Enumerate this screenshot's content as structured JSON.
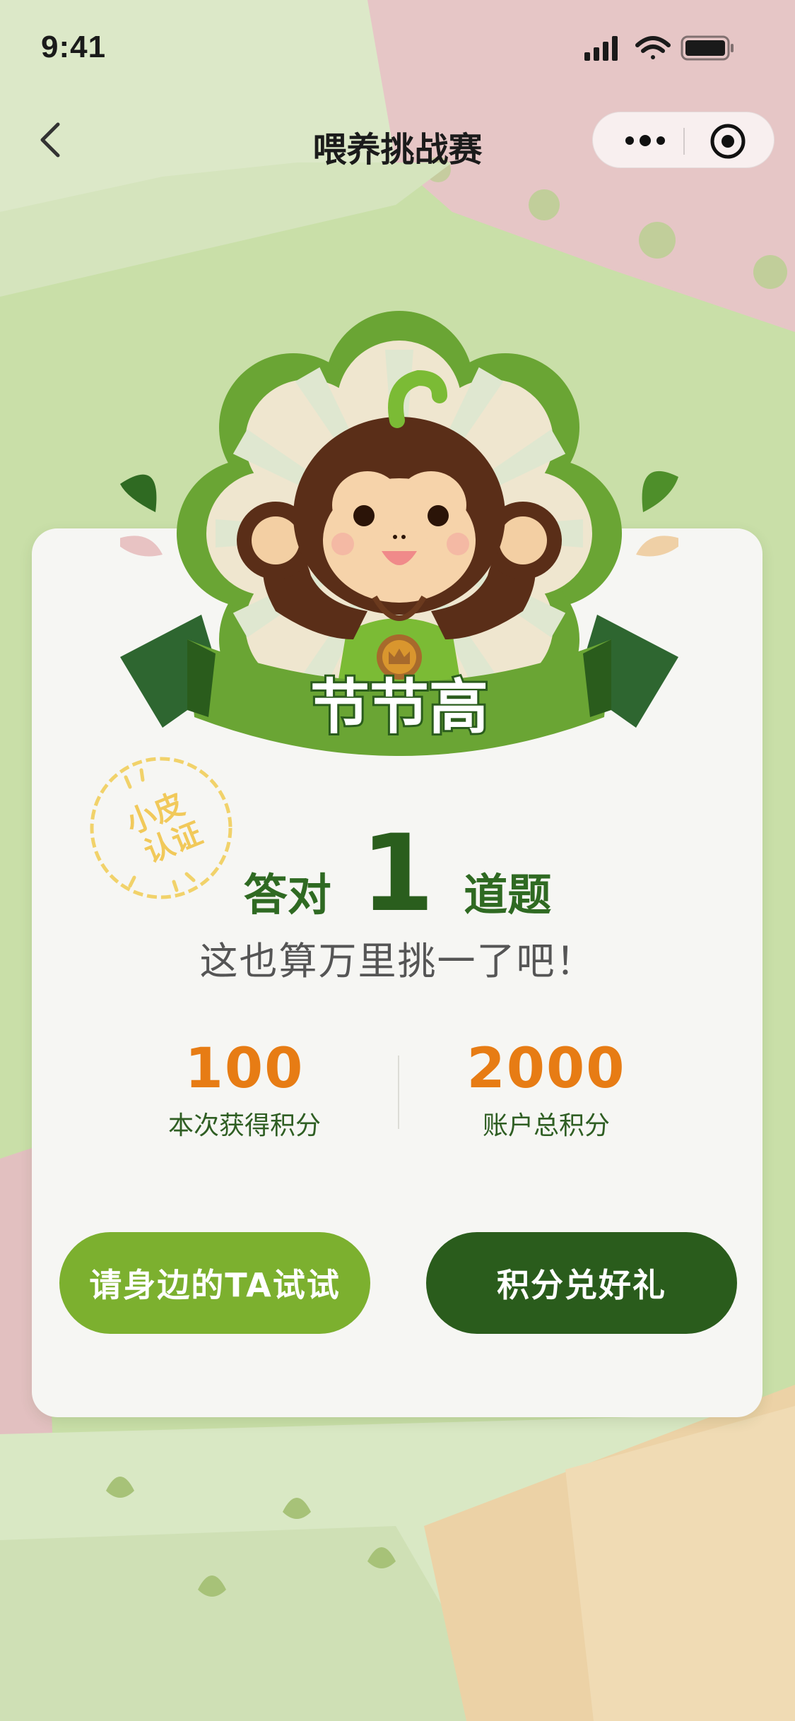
{
  "status_bar": {
    "time": "9:41"
  },
  "nav": {
    "title": "喂养挑战赛"
  },
  "badge": {
    "ribbon_text": "节节高"
  },
  "stamp": {
    "text_line1": "小皮",
    "text_line2": "认证"
  },
  "result": {
    "lead": "答对",
    "count": "1",
    "tail": "道题",
    "subtitle": "这也算万里挑一了吧！"
  },
  "stats": {
    "earned_value": "100",
    "earned_label": "本次获得积分",
    "total_value": "2000",
    "total_label": "账户总积分"
  },
  "buttons": {
    "invite_label": "请身边的TA试试",
    "redeem_label": "积分兑好礼"
  },
  "colors": {
    "primary_dark_green": "#2a5c1c",
    "primary_light_green": "#7cb02f",
    "points_orange": "#e77c14"
  }
}
